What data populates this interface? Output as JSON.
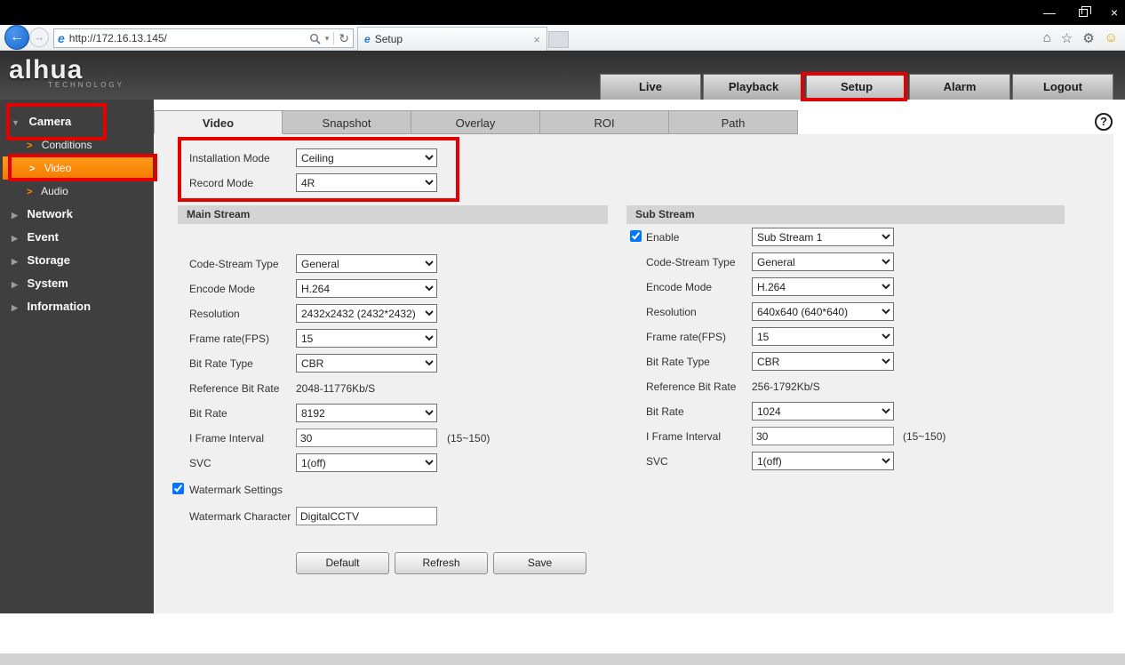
{
  "window": {
    "minimize": "—",
    "close": "×"
  },
  "browser": {
    "url": "http://172.16.13.145/",
    "tab_title": "Setup"
  },
  "icons": {
    "back": "←",
    "forward": "→",
    "dropdown": "▾",
    "refresh": "↻",
    "home": "⌂",
    "star": "☆",
    "gear": "⚙",
    "smiley": "☺",
    "tab_close": "×",
    "ie": "e",
    "triangle_down": "▼",
    "triangle_right": "▶",
    "child_arrow": ">",
    "help": "?"
  },
  "header": {
    "logo": "alhua",
    "logo_sub": "TECHNOLOGY",
    "nav_live": "Live",
    "nav_playback": "Playback",
    "nav_setup": "Setup",
    "nav_alarm": "Alarm",
    "nav_logout": "Logout"
  },
  "sidebar": {
    "camera": "Camera",
    "conditions": "Conditions",
    "video": "Video",
    "audio": "Audio",
    "network": "Network",
    "event": "Event",
    "storage": "Storage",
    "system": "System",
    "information": "Information"
  },
  "tabs": {
    "video": "Video",
    "snapshot": "Snapshot",
    "overlay": "Overlay",
    "roi": "ROI",
    "path": "Path"
  },
  "general": {
    "installation_mode_label": "Installation Mode",
    "installation_mode_value": "Ceiling",
    "record_mode_label": "Record Mode",
    "record_mode_value": "4R"
  },
  "main_stream": {
    "title": "Main Stream",
    "code_stream_type_label": "Code-Stream Type",
    "code_stream_type_value": "General",
    "encode_mode_label": "Encode Mode",
    "encode_mode_value": "H.264",
    "resolution_label": "Resolution",
    "resolution_value": "2432x2432 (2432*2432)",
    "frame_rate_label": "Frame rate(FPS)",
    "frame_rate_value": "15",
    "bit_rate_type_label": "Bit Rate Type",
    "bit_rate_type_value": "CBR",
    "reference_bit_rate_label": "Reference Bit Rate",
    "reference_bit_rate_value": "2048-11776Kb/S",
    "bit_rate_label": "Bit Rate",
    "bit_rate_value": "8192",
    "i_frame_interval_label": "I Frame Interval",
    "i_frame_interval_value": "30",
    "i_frame_interval_hint": "(15~150)",
    "svc_label": "SVC",
    "svc_value": "1(off)",
    "watermark_settings_label": "Watermark Settings",
    "watermark_character_label": "Watermark Character",
    "watermark_character_value": "DigitalCCTV"
  },
  "sub_stream": {
    "title": "Sub Stream",
    "enable_label": "Enable",
    "enable_value": "Sub Stream 1",
    "code_stream_type_label": "Code-Stream Type",
    "code_stream_type_value": "General",
    "encode_mode_label": "Encode Mode",
    "encode_mode_value": "H.264",
    "resolution_label": "Resolution",
    "resolution_value": "640x640 (640*640)",
    "frame_rate_label": "Frame rate(FPS)",
    "frame_rate_value": "15",
    "bit_rate_type_label": "Bit Rate Type",
    "bit_rate_type_value": "CBR",
    "reference_bit_rate_label": "Reference Bit Rate",
    "reference_bit_rate_value": "256-1792Kb/S",
    "bit_rate_label": "Bit Rate",
    "bit_rate_value": "1024",
    "i_frame_interval_label": "I Frame Interval",
    "i_frame_interval_value": "30",
    "i_frame_interval_hint": "(15~150)",
    "svc_label": "SVC",
    "svc_value": "1(off)"
  },
  "actions": {
    "default": "Default",
    "refresh": "Refresh",
    "save": "Save"
  }
}
